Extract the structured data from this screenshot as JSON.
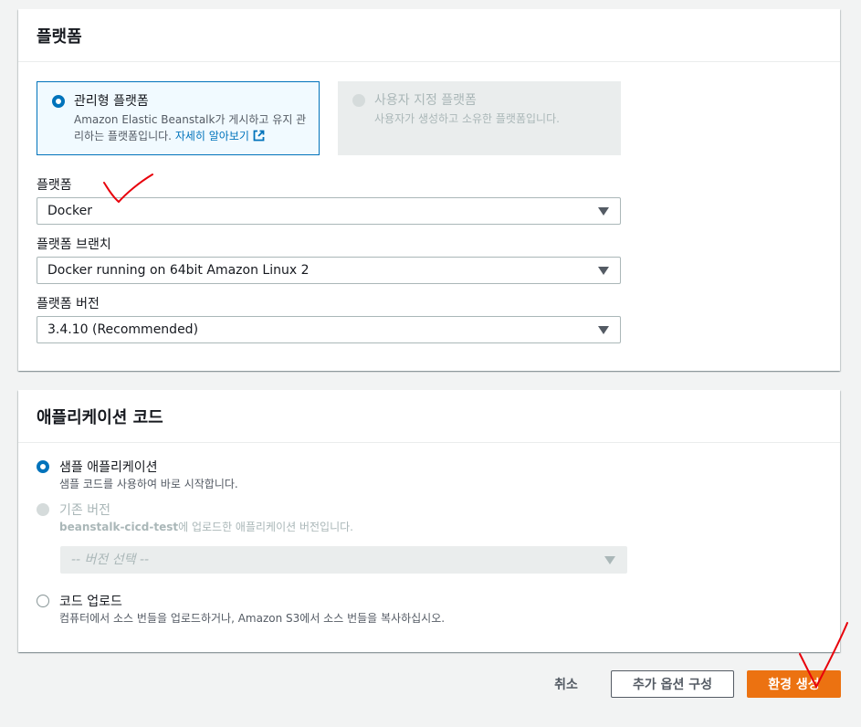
{
  "platform_section": {
    "title": "플랫폼",
    "managed_tile": {
      "label": "관리형 플랫폼",
      "desc_line1": "Amazon Elastic Beanstalk가 게시하고 유지 관",
      "desc_line2": "리하는 플랫폼입니다.",
      "learn_more": "자세히 알아보기"
    },
    "custom_tile": {
      "label": "사용자 지정 플랫폼",
      "desc": "사용자가 생성하고 소유한 플랫폼입니다."
    },
    "platform_label": "플랫폼",
    "platform_value": "Docker",
    "branch_label": "플랫폼 브랜치",
    "branch_value": "Docker running on 64bit Amazon Linux 2",
    "version_label": "플랫폼 버전",
    "version_value": "3.4.10 (Recommended)"
  },
  "code_section": {
    "title": "애플리케이션 코드",
    "sample": {
      "label": "샘플 애플리케이션",
      "desc": "샘플 코드를 사용하여 바로 시작합니다."
    },
    "existing": {
      "label": "기존 버전",
      "desc_bold": "beanstalk-cicd-test",
      "desc_rest": "에 업로드한 애플리케이션 버전입니다.",
      "select_placeholder": "-- 버전 선택 --"
    },
    "upload": {
      "label": "코드 업로드",
      "desc": "컴퓨터에서 소스 번들을 업로드하거나, Amazon S3에서 소스 번들을 복사하십시오."
    }
  },
  "footer": {
    "cancel": "취소",
    "more_options": "추가 옵션 구성",
    "create": "환경 생성"
  },
  "colors": {
    "accent": "#0073bb",
    "primary_button": "#ec7211",
    "annotation": "#e8000b"
  }
}
